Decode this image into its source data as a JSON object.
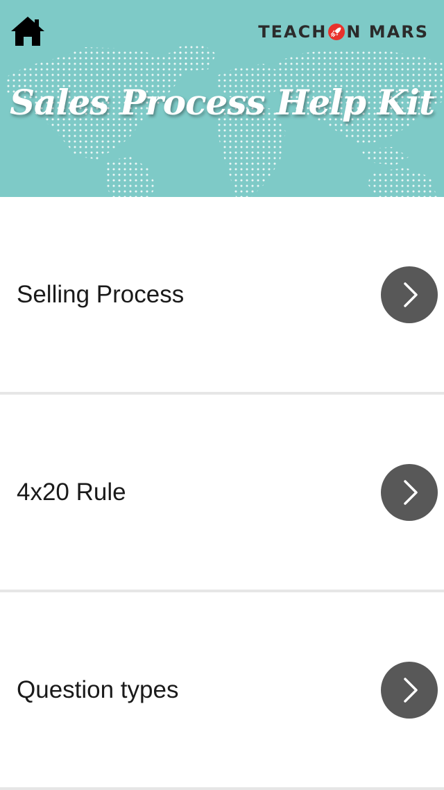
{
  "header": {
    "title": "Sales Process Help Kit",
    "brand_left": "TEACH",
    "brand_right": "N MARS",
    "home_icon": "home-icon",
    "brand_icon": "rocket-icon",
    "background_color": "#7ecac7",
    "accent_color": "#e8322c"
  },
  "menu": {
    "items": [
      {
        "label": "Selling Process",
        "icon": "chevron-right-icon"
      },
      {
        "label": "4x20 Rule",
        "icon": "chevron-right-icon"
      },
      {
        "label": "Question types",
        "icon": "chevron-right-icon"
      }
    ]
  }
}
